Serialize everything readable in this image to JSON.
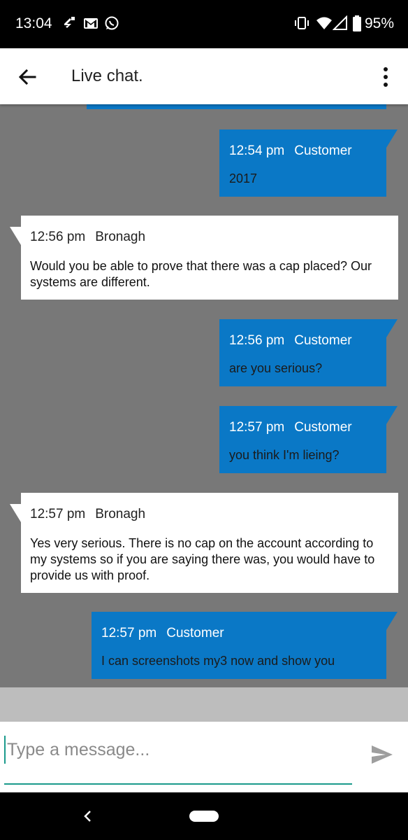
{
  "status_bar": {
    "time": "13:04",
    "battery_percent": "95%",
    "left_icons": [
      "usb-debug-icon",
      "gmail-icon",
      "whatsapp-icon"
    ],
    "right_icons": [
      "vibrate-icon",
      "wifi-icon",
      "signal-icon",
      "battery-icon"
    ]
  },
  "app_bar": {
    "title": "Live chat.",
    "back_icon": "arrow-left-icon",
    "menu_icon": "more-vert-icon"
  },
  "colors": {
    "outgoing_bubble": "#0a78c6",
    "incoming_bubble": "#ffffff",
    "chat_background": "#787878",
    "accent": "#1a9a8c"
  },
  "messages": [
    {
      "direction": "out",
      "time": "12:54 pm",
      "sender": "Customer",
      "text": "2017"
    },
    {
      "direction": "in",
      "time": "12:56 pm",
      "sender": "Bronagh",
      "text": "Would you be able to prove that there was a cap placed? Our systems are different."
    },
    {
      "direction": "out",
      "time": "12:56 pm",
      "sender": "Customer",
      "text": "are you serious?"
    },
    {
      "direction": "out",
      "time": "12:57 pm",
      "sender": "Customer",
      "text": "you think I'm lieing?"
    },
    {
      "direction": "in",
      "time": "12:57 pm",
      "sender": "Bronagh",
      "text": "Yes very serious. There is no cap on the account according to my systems so if you are saying there was, you would have to provide us with proof."
    },
    {
      "direction": "out",
      "time": "12:57 pm",
      "sender": "Customer",
      "text": "I can screenshots my3 now and show you"
    }
  ],
  "composer": {
    "value": "",
    "placeholder": "Type a message...",
    "send_icon": "send-icon"
  },
  "nav_bar": {
    "back_icon": "nav-back-icon",
    "home_icon": "home-pill-icon"
  }
}
